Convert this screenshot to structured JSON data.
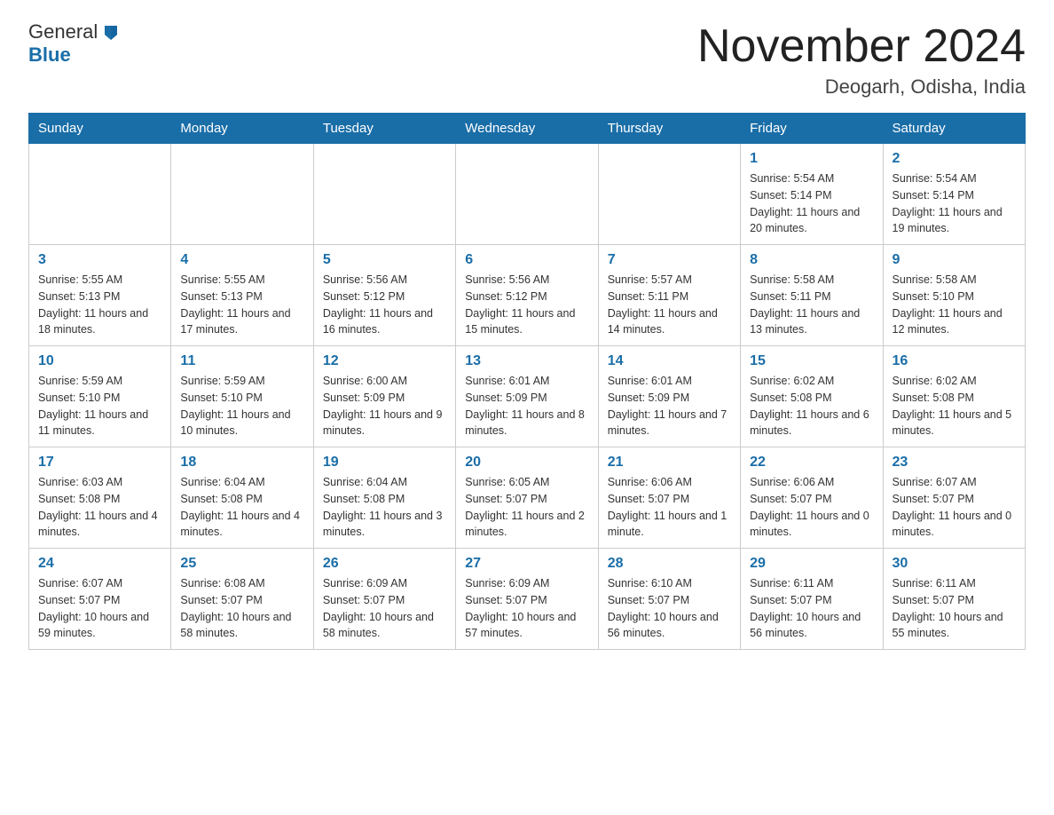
{
  "header": {
    "month_title": "November 2024",
    "location": "Deogarh, Odisha, India",
    "logo_general": "General",
    "logo_blue": "Blue"
  },
  "days_of_week": [
    "Sunday",
    "Monday",
    "Tuesday",
    "Wednesday",
    "Thursday",
    "Friday",
    "Saturday"
  ],
  "weeks": [
    [
      {
        "day": "",
        "info": ""
      },
      {
        "day": "",
        "info": ""
      },
      {
        "day": "",
        "info": ""
      },
      {
        "day": "",
        "info": ""
      },
      {
        "day": "",
        "info": ""
      },
      {
        "day": "1",
        "info": "Sunrise: 5:54 AM\nSunset: 5:14 PM\nDaylight: 11 hours and 20 minutes."
      },
      {
        "day": "2",
        "info": "Sunrise: 5:54 AM\nSunset: 5:14 PM\nDaylight: 11 hours and 19 minutes."
      }
    ],
    [
      {
        "day": "3",
        "info": "Sunrise: 5:55 AM\nSunset: 5:13 PM\nDaylight: 11 hours and 18 minutes."
      },
      {
        "day": "4",
        "info": "Sunrise: 5:55 AM\nSunset: 5:13 PM\nDaylight: 11 hours and 17 minutes."
      },
      {
        "day": "5",
        "info": "Sunrise: 5:56 AM\nSunset: 5:12 PM\nDaylight: 11 hours and 16 minutes."
      },
      {
        "day": "6",
        "info": "Sunrise: 5:56 AM\nSunset: 5:12 PM\nDaylight: 11 hours and 15 minutes."
      },
      {
        "day": "7",
        "info": "Sunrise: 5:57 AM\nSunset: 5:11 PM\nDaylight: 11 hours and 14 minutes."
      },
      {
        "day": "8",
        "info": "Sunrise: 5:58 AM\nSunset: 5:11 PM\nDaylight: 11 hours and 13 minutes."
      },
      {
        "day": "9",
        "info": "Sunrise: 5:58 AM\nSunset: 5:10 PM\nDaylight: 11 hours and 12 minutes."
      }
    ],
    [
      {
        "day": "10",
        "info": "Sunrise: 5:59 AM\nSunset: 5:10 PM\nDaylight: 11 hours and 11 minutes."
      },
      {
        "day": "11",
        "info": "Sunrise: 5:59 AM\nSunset: 5:10 PM\nDaylight: 11 hours and 10 minutes."
      },
      {
        "day": "12",
        "info": "Sunrise: 6:00 AM\nSunset: 5:09 PM\nDaylight: 11 hours and 9 minutes."
      },
      {
        "day": "13",
        "info": "Sunrise: 6:01 AM\nSunset: 5:09 PM\nDaylight: 11 hours and 8 minutes."
      },
      {
        "day": "14",
        "info": "Sunrise: 6:01 AM\nSunset: 5:09 PM\nDaylight: 11 hours and 7 minutes."
      },
      {
        "day": "15",
        "info": "Sunrise: 6:02 AM\nSunset: 5:08 PM\nDaylight: 11 hours and 6 minutes."
      },
      {
        "day": "16",
        "info": "Sunrise: 6:02 AM\nSunset: 5:08 PM\nDaylight: 11 hours and 5 minutes."
      }
    ],
    [
      {
        "day": "17",
        "info": "Sunrise: 6:03 AM\nSunset: 5:08 PM\nDaylight: 11 hours and 4 minutes."
      },
      {
        "day": "18",
        "info": "Sunrise: 6:04 AM\nSunset: 5:08 PM\nDaylight: 11 hours and 4 minutes."
      },
      {
        "day": "19",
        "info": "Sunrise: 6:04 AM\nSunset: 5:08 PM\nDaylight: 11 hours and 3 minutes."
      },
      {
        "day": "20",
        "info": "Sunrise: 6:05 AM\nSunset: 5:07 PM\nDaylight: 11 hours and 2 minutes."
      },
      {
        "day": "21",
        "info": "Sunrise: 6:06 AM\nSunset: 5:07 PM\nDaylight: 11 hours and 1 minute."
      },
      {
        "day": "22",
        "info": "Sunrise: 6:06 AM\nSunset: 5:07 PM\nDaylight: 11 hours and 0 minutes."
      },
      {
        "day": "23",
        "info": "Sunrise: 6:07 AM\nSunset: 5:07 PM\nDaylight: 11 hours and 0 minutes."
      }
    ],
    [
      {
        "day": "24",
        "info": "Sunrise: 6:07 AM\nSunset: 5:07 PM\nDaylight: 10 hours and 59 minutes."
      },
      {
        "day": "25",
        "info": "Sunrise: 6:08 AM\nSunset: 5:07 PM\nDaylight: 10 hours and 58 minutes."
      },
      {
        "day": "26",
        "info": "Sunrise: 6:09 AM\nSunset: 5:07 PM\nDaylight: 10 hours and 58 minutes."
      },
      {
        "day": "27",
        "info": "Sunrise: 6:09 AM\nSunset: 5:07 PM\nDaylight: 10 hours and 57 minutes."
      },
      {
        "day": "28",
        "info": "Sunrise: 6:10 AM\nSunset: 5:07 PM\nDaylight: 10 hours and 56 minutes."
      },
      {
        "day": "29",
        "info": "Sunrise: 6:11 AM\nSunset: 5:07 PM\nDaylight: 10 hours and 56 minutes."
      },
      {
        "day": "30",
        "info": "Sunrise: 6:11 AM\nSunset: 5:07 PM\nDaylight: 10 hours and 55 minutes."
      }
    ]
  ]
}
